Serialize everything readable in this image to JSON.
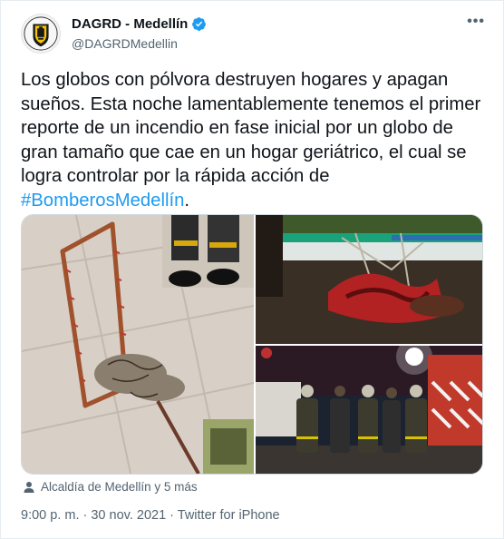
{
  "tweet": {
    "display_name": "DAGRD - Medellín",
    "handle": "@DAGRDMedellin",
    "text_main": "Los globos con pólvora destruyen hogares y apagan sueños. Esta noche lamentablemente tenemos el primer reporte de un incendio en fase inicial por un globo de gran tamaño que cae en un hogar geriátrico, el cual se logra controlar por la rápida acción de ",
    "hashtag": "#BomberosMedellín",
    "text_end": ".",
    "tagged": "Alcaldía de Medellín y 5 más",
    "timestamp": "9:00 p. m. · 30 nov. 2021 · Twitter for iPhone"
  },
  "icons": {
    "more": "more-options-icon",
    "verified": "verified-badge-icon",
    "tagged": "person-icon"
  },
  "colors": {
    "accent": "#1d9bf0",
    "text": "#0f1419",
    "secondary": "#536471"
  }
}
